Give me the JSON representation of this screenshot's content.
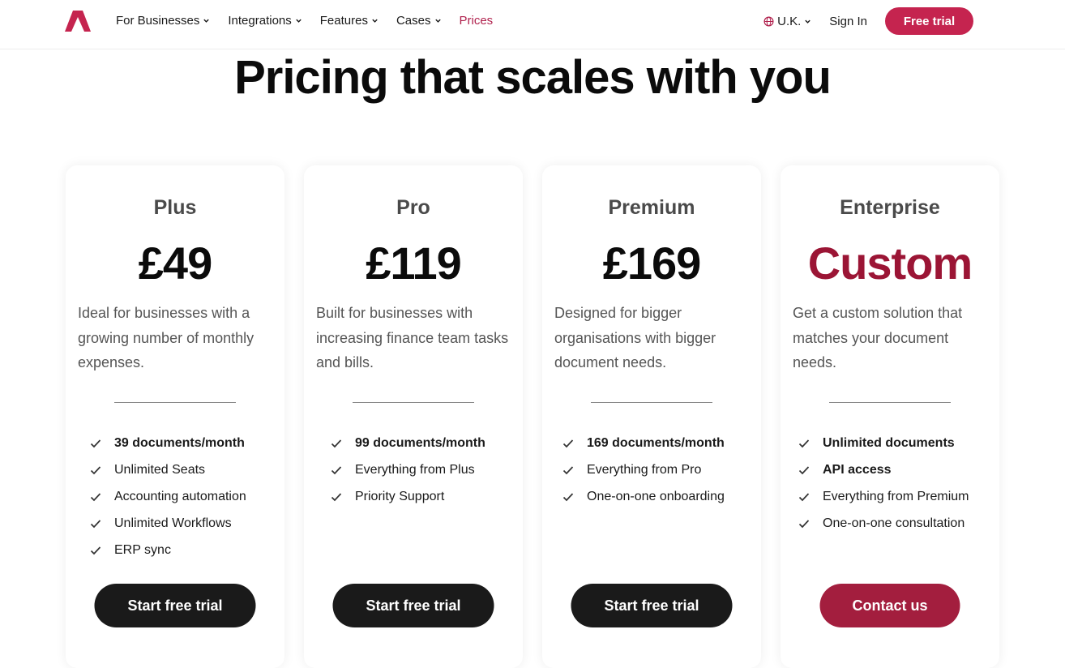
{
  "header": {
    "logo_icon": "brand-logo-icon",
    "nav": [
      {
        "label": "For Businesses",
        "dropdown": true,
        "active": false
      },
      {
        "label": "Integrations",
        "dropdown": true,
        "active": false
      },
      {
        "label": "Features",
        "dropdown": true,
        "active": false
      },
      {
        "label": "Cases",
        "dropdown": true,
        "active": false
      },
      {
        "label": "Prices",
        "dropdown": false,
        "active": true
      }
    ],
    "language": "U.K.",
    "sign_in": "Sign In",
    "free_trial": "Free trial"
  },
  "hero": {
    "title": "Pricing that scales with you"
  },
  "plans": [
    {
      "name": "Plus",
      "price": "£49",
      "description": "Ideal for businesses with a growing number of monthly expenses.",
      "features": [
        {
          "text": "39 documents/month",
          "bold": true
        },
        {
          "text": "Unlimited Seats",
          "bold": false
        },
        {
          "text": "Accounting automation",
          "bold": false
        },
        {
          "text": "Unlimited Workflows",
          "bold": false
        },
        {
          "text": "ERP sync",
          "bold": false
        }
      ],
      "cta": "Start free trial"
    },
    {
      "name": "Pro",
      "price": "£119",
      "description": "Built for businesses with increasing finance team tasks and bills.",
      "features": [
        {
          "text": "99 documents/month",
          "bold": true
        },
        {
          "text": "Everything from Plus",
          "bold": false
        },
        {
          "text": "Priority Support",
          "bold": false
        }
      ],
      "cta": "Start free trial"
    },
    {
      "name": "Premium",
      "price": "£169",
      "description": "Designed for bigger organisations with bigger document needs.",
      "features": [
        {
          "text": "169 documents/month",
          "bold": true
        },
        {
          "text": "Everything from Pro",
          "bold": false
        },
        {
          "text": "One-on-one onboarding",
          "bold": false
        }
      ],
      "cta": "Start free trial"
    },
    {
      "name": "Enterprise",
      "price": "Custom",
      "description": "Get a custom solution that matches your document needs.",
      "features": [
        {
          "text": "Unlimited documents",
          "bold": true
        },
        {
          "text": "API access",
          "bold": true
        },
        {
          "text": "Everything from Premium",
          "bold": false
        },
        {
          "text": "One-on-one consultation",
          "bold": false
        }
      ],
      "cta": "Contact us"
    }
  ],
  "colors": {
    "accent": "#c5244f",
    "accent_dark": "#9b1535",
    "button_dark": "#1a1a1a"
  }
}
